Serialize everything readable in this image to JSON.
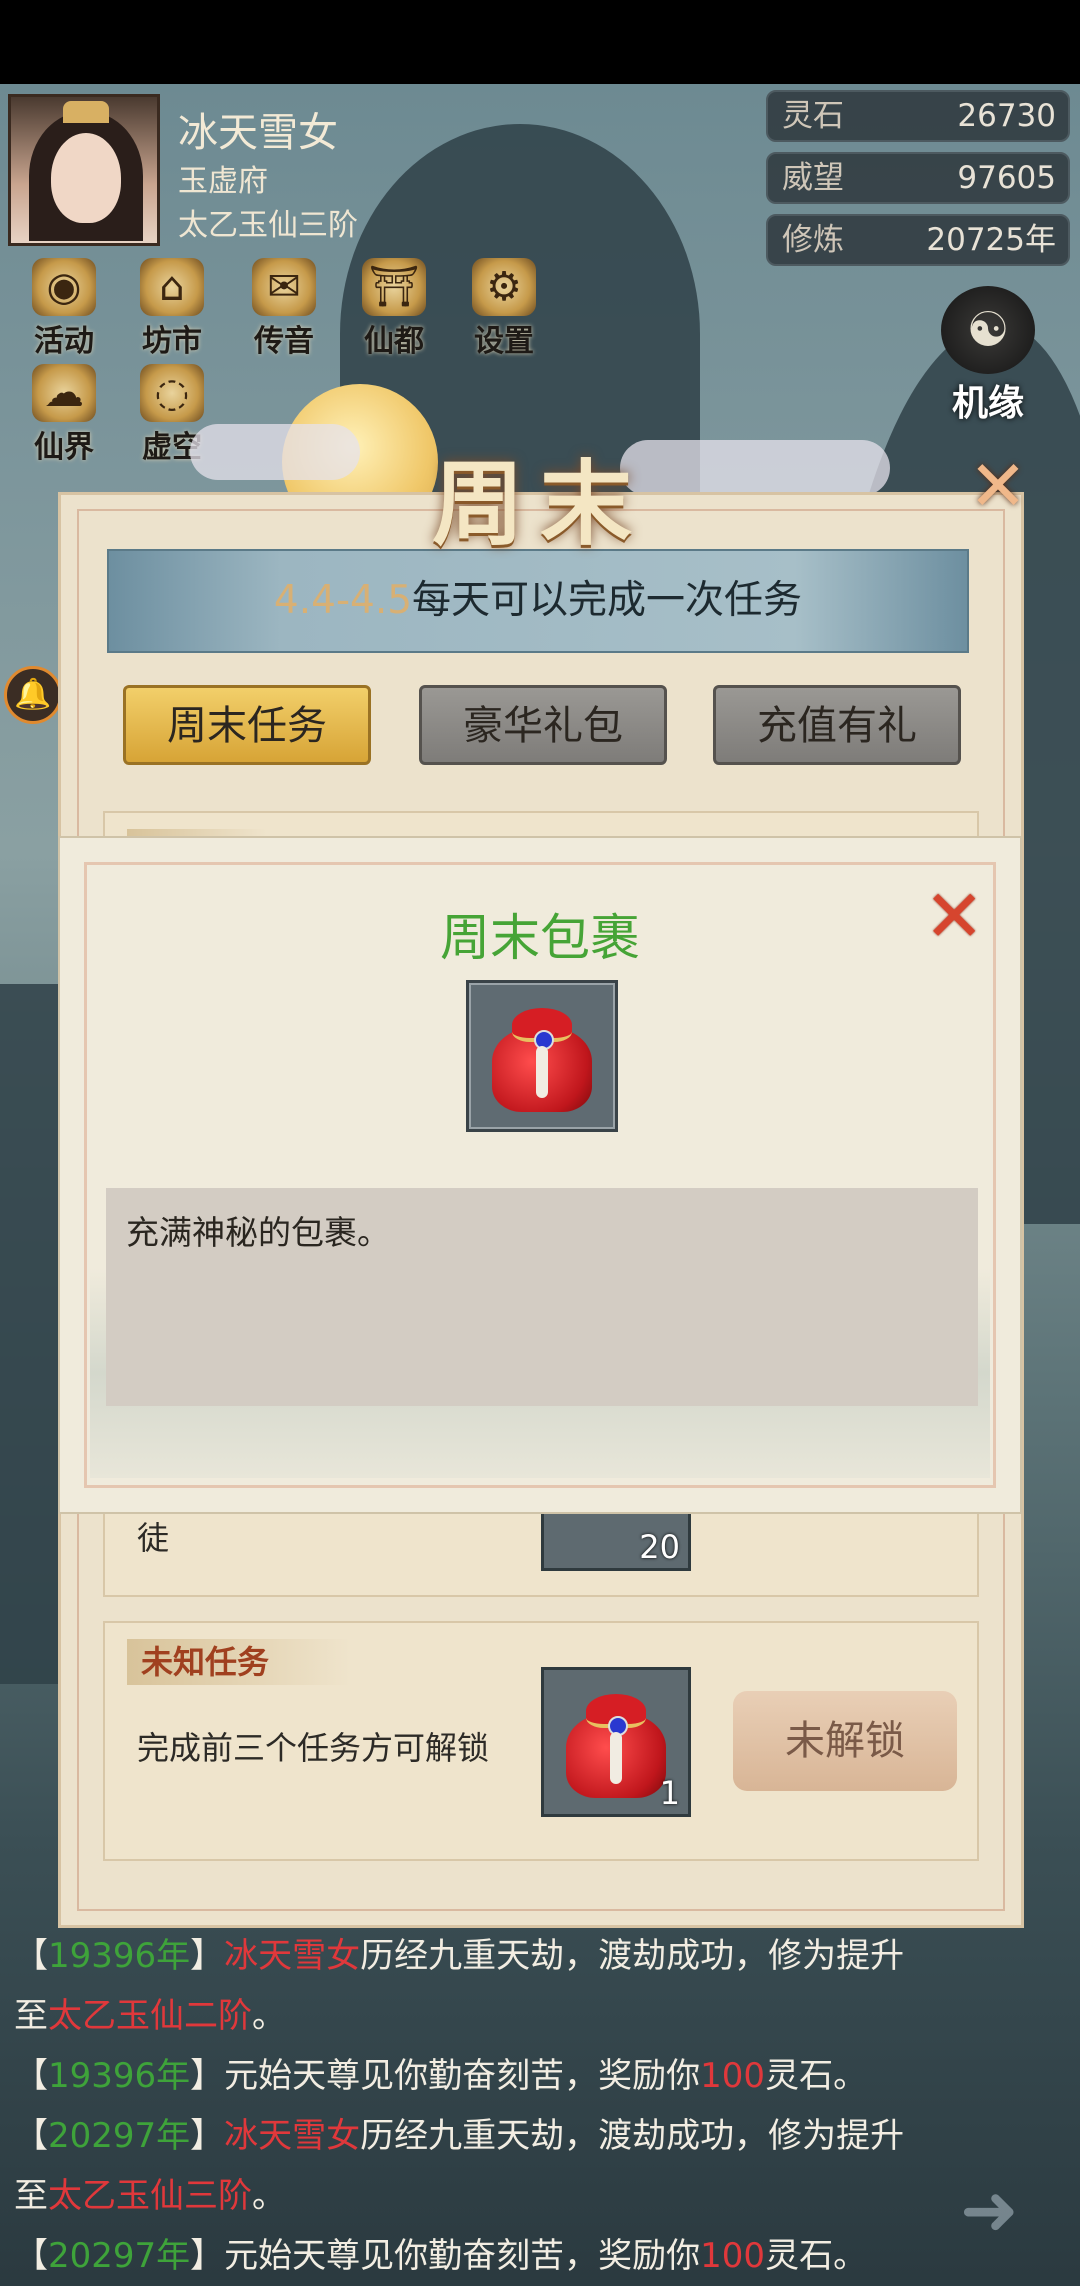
{
  "player": {
    "name": "冰天雪女",
    "sect": "玉虚府",
    "realm": "太乙玉仙三阶"
  },
  "resources": [
    {
      "label": "灵石",
      "value": "26730"
    },
    {
      "label": "威望",
      "value": "97605"
    },
    {
      "label": "修炼",
      "value": "20725年"
    }
  ],
  "menu_row1": [
    {
      "label": "活动",
      "icon": "coin-icon",
      "glyph": "◉"
    },
    {
      "label": "坊市",
      "icon": "market-icon",
      "glyph": "⌂"
    },
    {
      "label": "传音",
      "icon": "mail-icon",
      "glyph": "✉"
    },
    {
      "label": "仙都",
      "icon": "pavilion-icon",
      "glyph": "⛩"
    },
    {
      "label": "设置",
      "icon": "gear-icon",
      "glyph": "⚙"
    }
  ],
  "menu_row2": [
    {
      "label": "仙界",
      "icon": "realm-icon",
      "glyph": "☁"
    },
    {
      "label": "虚空",
      "icon": "void-icon",
      "glyph": "◌"
    }
  ],
  "jiyuan": {
    "label": "机缘",
    "icon": "fortune-icon",
    "glyph": "☯"
  },
  "weekend": {
    "title": "周末",
    "banner_date": "4.4-4.5",
    "banner_text": "每天可以完成一次任务",
    "tabs": [
      "周末任务",
      "豪华礼包",
      "充值有礼"
    ],
    "active_tab": 0,
    "partial_label": "徒",
    "partial_count": "20",
    "unknown_task": {
      "tag": "未知任务",
      "desc": "完成前三个任务方可解锁",
      "item_count": "1",
      "button": "未解锁"
    }
  },
  "modal": {
    "title": "周末包裹",
    "item_icon": "red-bag-icon",
    "description": "充满神秘的包裹。"
  },
  "log": [
    [
      {
        "t": "【",
        "c": ""
      },
      {
        "t": "19396年",
        "c": "g"
      },
      {
        "t": "】",
        "c": ""
      },
      {
        "t": "冰天雪女",
        "c": "r"
      },
      {
        "t": "历经九重天劫，渡劫成功，修为提升",
        "c": ""
      }
    ],
    [
      {
        "t": "至",
        "c": ""
      },
      {
        "t": "太乙玉仙二阶",
        "c": "r"
      },
      {
        "t": "。",
        "c": ""
      }
    ],
    [
      {
        "t": "【",
        "c": ""
      },
      {
        "t": "19396年",
        "c": "g"
      },
      {
        "t": "】元始天尊见你勤奋刻苦，奖励你",
        "c": ""
      },
      {
        "t": "100",
        "c": "r"
      },
      {
        "t": "灵石。",
        "c": ""
      }
    ],
    [
      {
        "t": "【",
        "c": ""
      },
      {
        "t": "20297年",
        "c": "g"
      },
      {
        "t": "】",
        "c": ""
      },
      {
        "t": "冰天雪女",
        "c": "r"
      },
      {
        "t": "历经九重天劫，渡劫成功，修为提升",
        "c": ""
      }
    ],
    [
      {
        "t": "至",
        "c": ""
      },
      {
        "t": "太乙玉仙三阶",
        "c": "r"
      },
      {
        "t": "。",
        "c": ""
      }
    ],
    [
      {
        "t": "【",
        "c": ""
      },
      {
        "t": "20297年",
        "c": "g"
      },
      {
        "t": "】元始天尊见你勤奋刻苦，奖励你",
        "c": ""
      },
      {
        "t": "100",
        "c": "r"
      },
      {
        "t": "灵石。",
        "c": ""
      }
    ]
  ],
  "colors": {
    "green": "#3ea33a",
    "red": "#e0383b",
    "modal_title": "#46a436",
    "tab_active": "#e0b74e"
  }
}
